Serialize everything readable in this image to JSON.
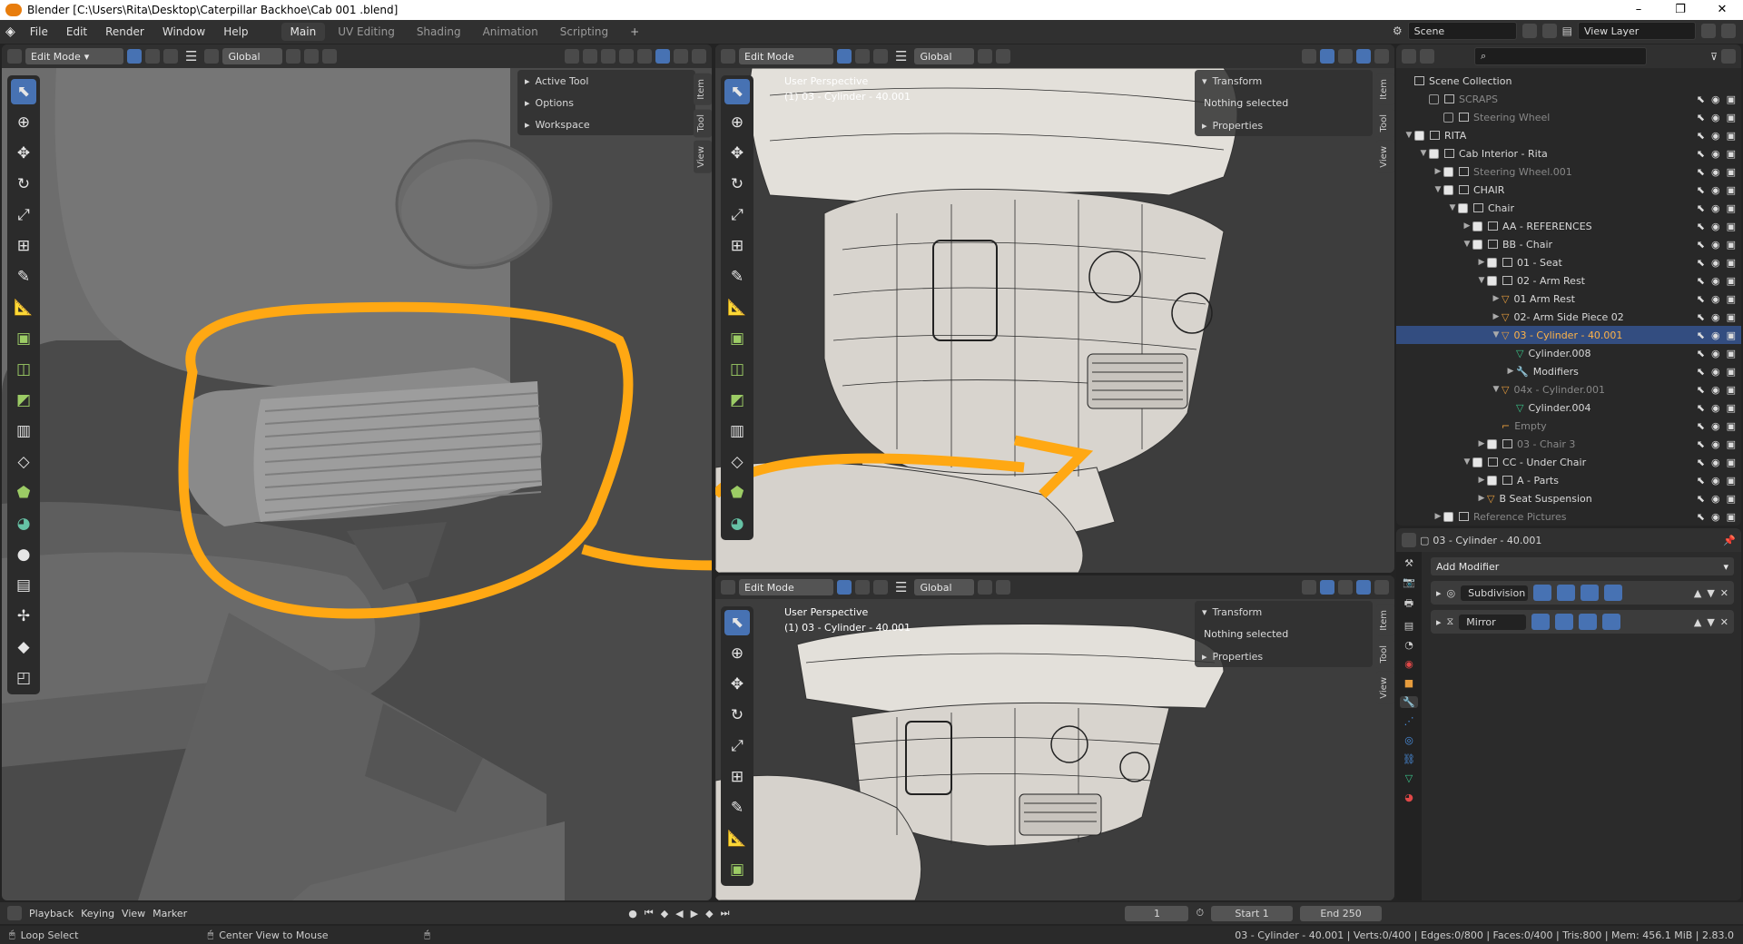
{
  "window": {
    "title": "Blender [C:\\Users\\Rita\\Desktop\\Caterpillar Backhoe\\Cab 001 .blend]",
    "minimize": "–",
    "maximize": "❐",
    "close": "✕"
  },
  "menu": [
    "File",
    "Edit",
    "Render",
    "Window",
    "Help"
  ],
  "workspaces": [
    {
      "label": "Main",
      "active": true
    },
    {
      "label": "UV Editing",
      "active": false
    },
    {
      "label": "Shading",
      "active": false
    },
    {
      "label": "Animation",
      "active": false
    },
    {
      "label": "Scripting",
      "active": false
    }
  ],
  "workspace_add": "+",
  "scene": {
    "label": "Scene",
    "view_layer": "View Layer"
  },
  "viewport_header": {
    "mode": "Edit Mode",
    "orientation": "Global"
  },
  "left_panel": {
    "items": [
      "Active Tool",
      "Options",
      "Workspace"
    ]
  },
  "side_tabs": [
    "Item",
    "Tool",
    "View"
  ],
  "viewport_top": {
    "perspective": "User Perspective",
    "object": "(1) 03 - Cylinder - 40.001"
  },
  "viewport_bottom": {
    "perspective": "User Perspective",
    "object": "(1) 03 - Cylinder - 40.001"
  },
  "npanel": {
    "transform": "Transform",
    "nothing": "Nothing selected",
    "properties": "Properties"
  },
  "outliner": {
    "search_placeholder": "",
    "rows": [
      {
        "label": "Scene Collection",
        "indent": 0,
        "arrow": "",
        "check": false,
        "type": "scene",
        "dim": false,
        "sel": false
      },
      {
        "label": "SCRAPS",
        "indent": 1,
        "arrow": "",
        "check": "off",
        "type": "col",
        "dim": true,
        "sel": false
      },
      {
        "label": "Steering Wheel",
        "indent": 2,
        "arrow": "",
        "check": "off",
        "type": "col",
        "dim": true,
        "sel": false
      },
      {
        "label": "RITA",
        "indent": 0,
        "arrow": "▼",
        "check": "on",
        "type": "col",
        "dim": false,
        "sel": false
      },
      {
        "label": "Cab Interior - Rita",
        "indent": 1,
        "arrow": "▼",
        "check": "on",
        "type": "col",
        "dim": false,
        "sel": false
      },
      {
        "label": "Steering Wheel.001",
        "indent": 2,
        "arrow": "▶",
        "check": "on",
        "type": "col",
        "dim": true,
        "sel": false
      },
      {
        "label": "CHAIR",
        "indent": 2,
        "arrow": "▼",
        "check": "on",
        "type": "col",
        "dim": false,
        "sel": false
      },
      {
        "label": "Chair",
        "indent": 3,
        "arrow": "▼",
        "check": "on",
        "type": "col",
        "dim": false,
        "sel": false
      },
      {
        "label": "AA - REFERENCES",
        "indent": 4,
        "arrow": "▶",
        "check": "on",
        "type": "col",
        "dim": false,
        "sel": false
      },
      {
        "label": "BB - Chair",
        "indent": 4,
        "arrow": "▼",
        "check": "on",
        "type": "col",
        "dim": false,
        "sel": false
      },
      {
        "label": "01 - Seat",
        "indent": 5,
        "arrow": "▶",
        "check": "on",
        "type": "col",
        "dim": false,
        "sel": false
      },
      {
        "label": "02 - Arm Rest",
        "indent": 5,
        "arrow": "▼",
        "check": "on",
        "type": "col",
        "dim": false,
        "sel": false
      },
      {
        "label": "01 Arm Rest",
        "indent": 6,
        "arrow": "▶",
        "check": false,
        "type": "mesh",
        "dim": false,
        "sel": false
      },
      {
        "label": "02- Arm Side Piece 02",
        "indent": 6,
        "arrow": "▶",
        "check": false,
        "type": "mesh",
        "dim": false,
        "sel": false
      },
      {
        "label": "03 - Cylinder - 40.001",
        "indent": 6,
        "arrow": "▼",
        "check": false,
        "type": "mesh",
        "dim": false,
        "sel": true
      },
      {
        "label": "Cylinder.008",
        "indent": 7,
        "arrow": "",
        "check": false,
        "type": "data",
        "dim": false,
        "sel": false
      },
      {
        "label": "Modifiers",
        "indent": 7,
        "arrow": "▶",
        "check": false,
        "type": "wrench",
        "dim": false,
        "sel": false
      },
      {
        "label": "04x - Cylinder.001",
        "indent": 6,
        "arrow": "▼",
        "check": false,
        "type": "mesh",
        "dim": true,
        "sel": false
      },
      {
        "label": "Cylinder.004",
        "indent": 7,
        "arrow": "",
        "check": false,
        "type": "data",
        "dim": false,
        "sel": false
      },
      {
        "label": "Empty",
        "indent": 6,
        "arrow": "",
        "check": false,
        "type": "empty",
        "dim": true,
        "sel": false
      },
      {
        "label": "03 - Chair 3",
        "indent": 5,
        "arrow": "▶",
        "check": "on",
        "type": "col",
        "dim": true,
        "sel": false
      },
      {
        "label": "CC - Under Chair",
        "indent": 4,
        "arrow": "▼",
        "check": "on",
        "type": "col",
        "dim": false,
        "sel": false
      },
      {
        "label": "A - Parts",
        "indent": 5,
        "arrow": "▶",
        "check": "on",
        "type": "col",
        "dim": false,
        "sel": false
      },
      {
        "label": "B Seat Suspension",
        "indent": 5,
        "arrow": "▶",
        "check": false,
        "type": "mesh",
        "dim": false,
        "sel": false
      },
      {
        "label": "Reference Pictures",
        "indent": 2,
        "arrow": "▶",
        "check": "on",
        "type": "col",
        "dim": true,
        "sel": false
      }
    ]
  },
  "properties": {
    "object": "03 - Cylinder - 40.001",
    "add_modifier": "Add Modifier",
    "modifiers": [
      "Subdivision",
      "Mirror"
    ]
  },
  "timeline": {
    "playback": "Playback",
    "keying": "Keying",
    "view": "View",
    "marker": "Marker",
    "current_frame": "1",
    "start_label": "Start",
    "start": "1",
    "end_label": "End",
    "end": "250"
  },
  "status": {
    "left": "Loop Select",
    "middle": "Center View to Mouse",
    "right": "03 - Cylinder - 40.001 | Verts:0/400 | Edges:0/800 | Faces:0/400 | Tris:800 | Mem: 456.1 MiB | 2.83.0"
  },
  "annotation_color": "#ffa813",
  "accent": "#4772b3"
}
